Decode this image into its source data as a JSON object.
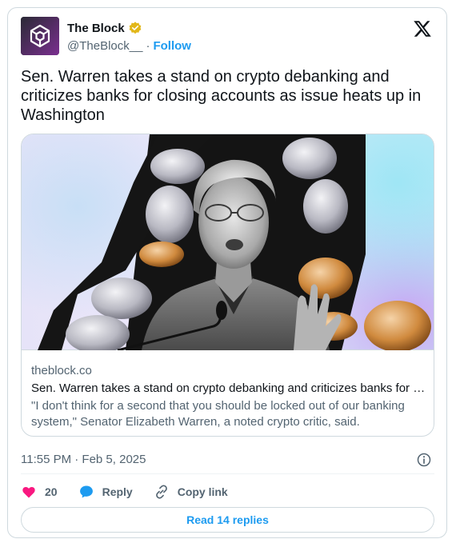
{
  "author": {
    "display_name": "The Block",
    "handle": "@TheBlock__",
    "separator": "·",
    "follow_label": "Follow",
    "verified_badge_color": "#e2b719"
  },
  "tweet": {
    "text": "Sen. Warren takes a stand on crypto debanking and criticizes banks for closing accounts as issue heats up in Washington"
  },
  "link_card": {
    "domain": "theblock.co",
    "title": "Sen. Warren takes a stand on crypto debanking and criticizes banks for c...",
    "description": "\"I don't think for a second that you should be locked out of our banking system,\" Senator Elizabeth Warren, a noted crypto critic, said."
  },
  "timestamp": "11:55 PM · Feb 5, 2025",
  "actions": {
    "like_count": "20",
    "reply_label": "Reply",
    "copy_link_label": "Copy link"
  },
  "read_replies_label": "Read 14 replies",
  "icons": {
    "avatar": "the-block-cube-logo",
    "verified": "verified-badge-icon",
    "platform": "x-logo-icon",
    "info": "info-icon",
    "like": "heart-icon",
    "reply": "speech-bubble-icon",
    "copy_link": "link-icon"
  },
  "colors": {
    "accent": "#1d9bf0",
    "like": "#f91880",
    "text_primary": "#0f1419",
    "text_secondary": "#536471",
    "border": "#cfd9de"
  }
}
